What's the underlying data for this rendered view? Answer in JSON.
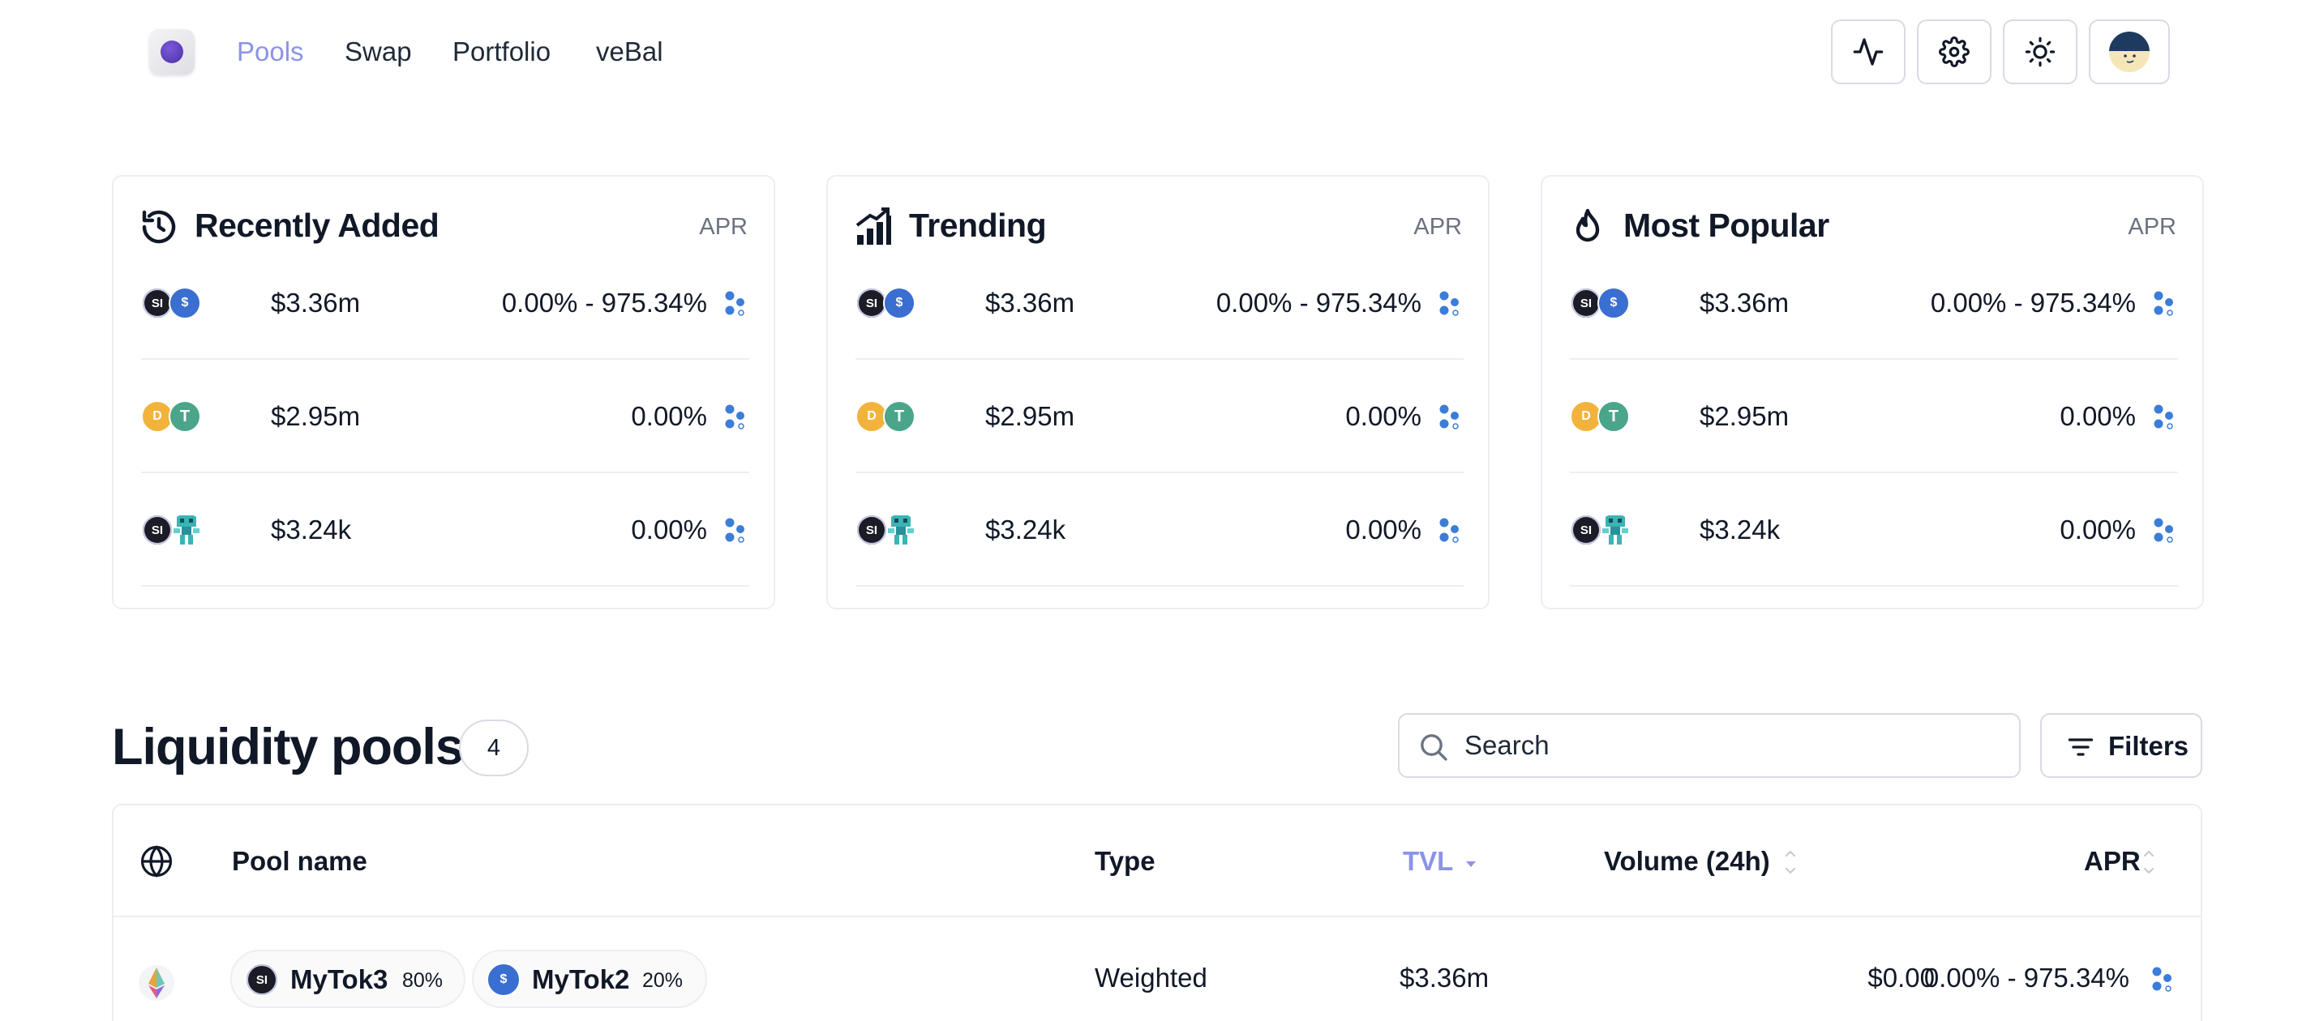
{
  "nav": {
    "links": [
      {
        "label": "Pools",
        "active": true
      },
      {
        "label": "Swap",
        "active": false
      },
      {
        "label": "Portfolio",
        "active": false
      },
      {
        "label": "veBal",
        "active": false
      }
    ],
    "icons": [
      "activity-icon",
      "gear-icon",
      "sun-icon",
      "avatar"
    ]
  },
  "featured": [
    {
      "title": "Recently Added",
      "icon": "history-icon",
      "apr_label": "APR",
      "rows": [
        {
          "tokens": [
            "SI",
            "USDC"
          ],
          "tvl": "$3.36m",
          "apr": "0.00% - 975.34%"
        },
        {
          "tokens": [
            "DAI",
            "USDT"
          ],
          "tvl": "$2.95m",
          "apr": "0.00%"
        },
        {
          "tokens": [
            "SI",
            "BOT"
          ],
          "tvl": "$3.24k",
          "apr": "0.00%"
        }
      ]
    },
    {
      "title": "Trending",
      "icon": "trending-up-icon",
      "apr_label": "APR",
      "rows": [
        {
          "tokens": [
            "SI",
            "USDC"
          ],
          "tvl": "$3.36m",
          "apr": "0.00% - 975.34%"
        },
        {
          "tokens": [
            "DAI",
            "USDT"
          ],
          "tvl": "$2.95m",
          "apr": "0.00%"
        },
        {
          "tokens": [
            "SI",
            "BOT"
          ],
          "tvl": "$3.24k",
          "apr": "0.00%"
        }
      ]
    },
    {
      "title": "Most Popular",
      "icon": "flame-icon",
      "apr_label": "APR",
      "rows": [
        {
          "tokens": [
            "SI",
            "USDC"
          ],
          "tvl": "$3.36m",
          "apr": "0.00% - 975.34%"
        },
        {
          "tokens": [
            "DAI",
            "USDT"
          ],
          "tvl": "$2.95m",
          "apr": "0.00%"
        },
        {
          "tokens": [
            "SI",
            "BOT"
          ],
          "tvl": "$3.24k",
          "apr": "0.00%"
        }
      ]
    }
  ],
  "pools": {
    "title": "Liquidity pools",
    "count": "4",
    "search_placeholder": "Search",
    "filters_label": "Filters",
    "columns": {
      "name": "Pool name",
      "type": "Type",
      "tvl": "TVL",
      "volume": "Volume (24h)",
      "apr": "APR"
    },
    "sorted_by": "TVL",
    "rows": [
      {
        "network": "ethereum-icon",
        "tokens": [
          {
            "symbol": "MyTok3",
            "weight": "80%",
            "icon": "SI"
          },
          {
            "symbol": "MyTok2",
            "weight": "20%",
            "icon": "USDC"
          }
        ],
        "type": "Weighted",
        "tvl": "$3.36m",
        "volume": "$0.00",
        "apr": "0.00% - 975.34%"
      }
    ]
  },
  "colors": {
    "accent": "#8b93e8",
    "text": "#111827",
    "muted": "#6b7280",
    "border": "#d8dbe2",
    "apr_dots": "#3b7dd8"
  }
}
